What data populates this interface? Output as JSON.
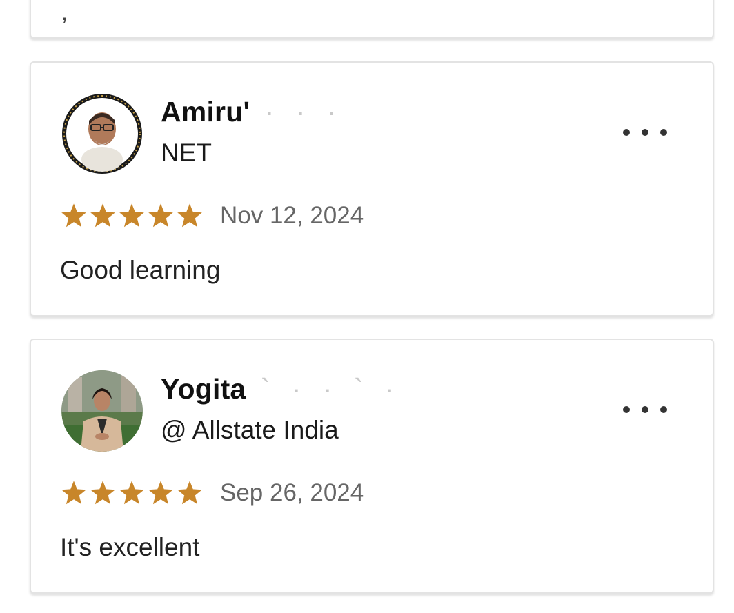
{
  "top_card": {
    "fragment": ","
  },
  "reviews": [
    {
      "name": "Amiru'",
      "name_faded": " · · · ",
      "headline": "NET",
      "rating": 5,
      "date": "Nov 12, 2024",
      "text": "Good learning",
      "avatar_icon": "profile-photo-man-glasses"
    },
    {
      "name": "Yogita",
      "name_faded": " ` · · ` · ",
      "headline": "@ Allstate India",
      "rating": 5,
      "date": "Sep 26, 2024",
      "text": "It's excellent",
      "avatar_icon": "profile-photo-woman-blazer"
    }
  ],
  "colors": {
    "star": "#C8862A",
    "border": "#e3e3e3",
    "date_text": "#666666"
  }
}
